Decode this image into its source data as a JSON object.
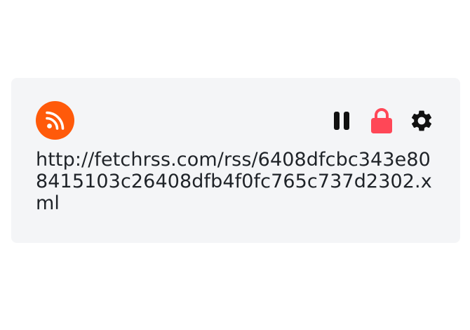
{
  "feed_card": {
    "url": "http://fetchrss.com/rss/6408dfcbc343e808415103c26408dfb4f0fc765c737d2302.xml",
    "icons": {
      "feed": "rss-icon",
      "pause": "pause-icon",
      "lock": "lock-icon",
      "settings": "gear-icon"
    },
    "colors": {
      "rss_badge": "#ff5a0a",
      "lock": "#ff4757",
      "icon_dark": "#111111",
      "card_background": "#f4f5f7"
    }
  }
}
